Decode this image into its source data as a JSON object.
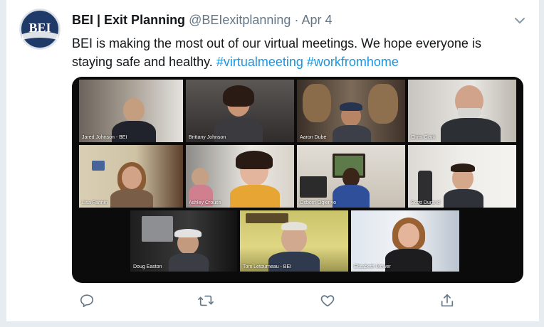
{
  "tweet": {
    "display_name": "BEI | Exit Planning",
    "handle": "@BEIexitplanning",
    "separator": "·",
    "date": "Apr 4",
    "avatar_text": "BEI",
    "text_plain": "BEI is making the most out of our virtual meetings. We hope everyone is staying safe and healthy. ",
    "hashtags": [
      "#virtualmeeting",
      "#workfromhome"
    ]
  },
  "media": {
    "participants": [
      "Jared Johnson - BEI",
      "Brittany Johnson",
      "Aaron Dube",
      "Chris Clark",
      "Lisa Fannin",
      "Ashley Crouse",
      "Osborn Ogienyo",
      "Scott Durand",
      "Doug Easton",
      "Tom Letourneau - BEI",
      "Elizabeth Mower"
    ]
  },
  "icons": {
    "reply": "reply-icon",
    "retweet": "retweet-icon",
    "like": "heart-icon",
    "share": "share-icon",
    "menu": "chevron-down-icon"
  },
  "colors": {
    "link": "#1b95e0",
    "text": "#14171a",
    "muted": "#657786",
    "brand_navy": "#1f3a68",
    "active_speaker": "#c9d74f"
  }
}
